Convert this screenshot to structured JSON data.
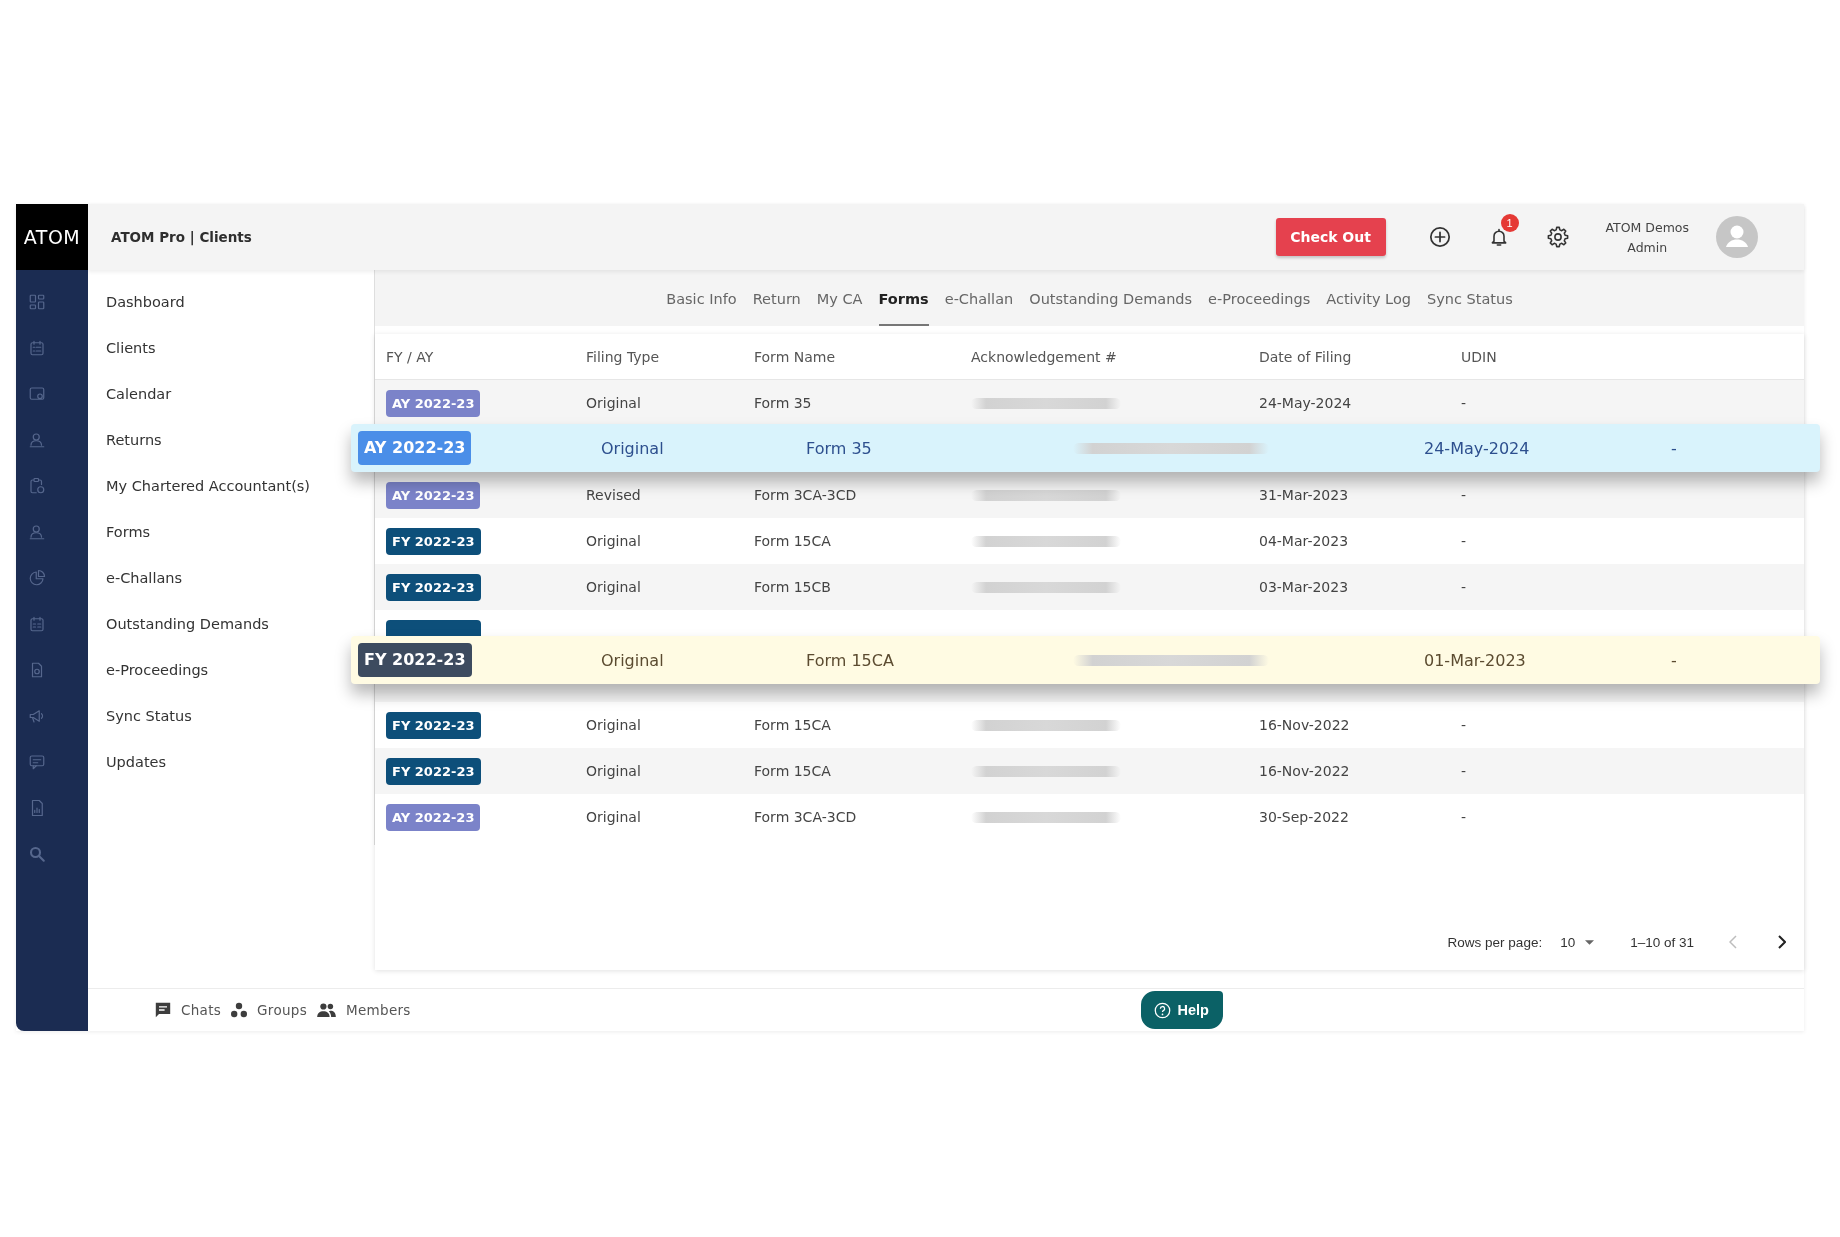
{
  "sidebar": {
    "logo": "ATOM"
  },
  "header": {
    "title": "ATOM Pro | Clients",
    "check_out": "Check Out",
    "notification_count": "1",
    "user_name": "ATOM Demos",
    "user_role": "Admin"
  },
  "nav": {
    "items": [
      "Dashboard",
      "Clients",
      "Calendar",
      "Returns",
      "My Chartered Accountant(s)",
      "Forms",
      "e-Challans",
      "Outstanding Demands",
      "e-Proceedings",
      "Sync Status",
      "Updates"
    ]
  },
  "tabs": [
    {
      "label": "Basic Info",
      "selected": false
    },
    {
      "label": "Return",
      "selected": false
    },
    {
      "label": "My CA",
      "selected": false
    },
    {
      "label": "Forms",
      "selected": true
    },
    {
      "label": "e-Challan",
      "selected": false
    },
    {
      "label": "Outstanding Demands",
      "selected": false
    },
    {
      "label": "e-Proceedings",
      "selected": false
    },
    {
      "label": "Activity Log",
      "selected": false
    },
    {
      "label": "Sync Status",
      "selected": false
    }
  ],
  "table": {
    "columns": [
      "FY / AY",
      "Filing Type",
      "Form Name",
      "Acknowledgement #",
      "Date of Filing",
      "UDIN"
    ],
    "rows": [
      {
        "kind": "row",
        "year": {
          "text": "AY 2022-23",
          "color": "#7b83c9"
        },
        "filing_type": "Original",
        "form_name": "Form 35",
        "date": "24-May-2024",
        "udin": "-"
      },
      {
        "kind": "dragged",
        "color": "#d9f3fc",
        "year": {
          "text": "AY 2022-23",
          "color": "#4a8ee8"
        },
        "filing_type": "Original",
        "form_name": "Form 35",
        "date": "24-May-2024",
        "udin": "-"
      },
      {
        "kind": "row",
        "year": {
          "text": "AY 2022-23",
          "color": "#7b83c9"
        },
        "filing_type": "Revised",
        "form_name": "Form 3CA-3CD",
        "date": "31-Mar-2023",
        "udin": "-"
      },
      {
        "kind": "row",
        "year": {
          "text": "FY 2022-23",
          "color": "#0d4f7a"
        },
        "filing_type": "Original",
        "form_name": "Form 15CA",
        "date": "04-Mar-2023",
        "udin": "-"
      },
      {
        "kind": "row",
        "year": {
          "text": "FY 2022-23",
          "color": "#0d4f7a"
        },
        "filing_type": "Original",
        "form_name": "Form 15CB",
        "date": "03-Mar-2023",
        "udin": "-"
      },
      {
        "kind": "covered",
        "year": {
          "color": "#0d4f7a"
        }
      },
      {
        "kind": "floating",
        "color": "#fffbe3",
        "year": {
          "text": "FY 2022-23",
          "color": "#3d4b5f"
        },
        "filing_type": "Original",
        "form_name": "Form 15CA",
        "date": "01-Mar-2023",
        "udin": "-"
      },
      {
        "kind": "covered"
      },
      {
        "kind": "row",
        "year": {
          "text": "FY 2022-23",
          "color": "#0d4f7a"
        },
        "filing_type": "Original",
        "form_name": "Form 15CA",
        "date": "16-Nov-2022",
        "udin": "-"
      },
      {
        "kind": "row",
        "year": {
          "text": "FY 2022-23",
          "color": "#0d4f7a"
        },
        "filing_type": "Original",
        "form_name": "Form 15CA",
        "date": "16-Nov-2022",
        "udin": "-"
      },
      {
        "kind": "row",
        "year": {
          "text": "AY 2022-23",
          "color": "#7b83c9"
        },
        "filing_type": "Original",
        "form_name": "Form 3CA-3CD",
        "date": "30-Sep-2022",
        "udin": "-"
      }
    ]
  },
  "pagination": {
    "rows_per_page_label": "Rows per page:",
    "rows_per_page": "10",
    "range": "1–10 of 31",
    "previous": {
      "disabled": true
    },
    "next": {
      "disabled": false
    }
  },
  "footer": {
    "links": [
      "Chats",
      "Groups",
      "Members"
    ],
    "help": "Help"
  }
}
